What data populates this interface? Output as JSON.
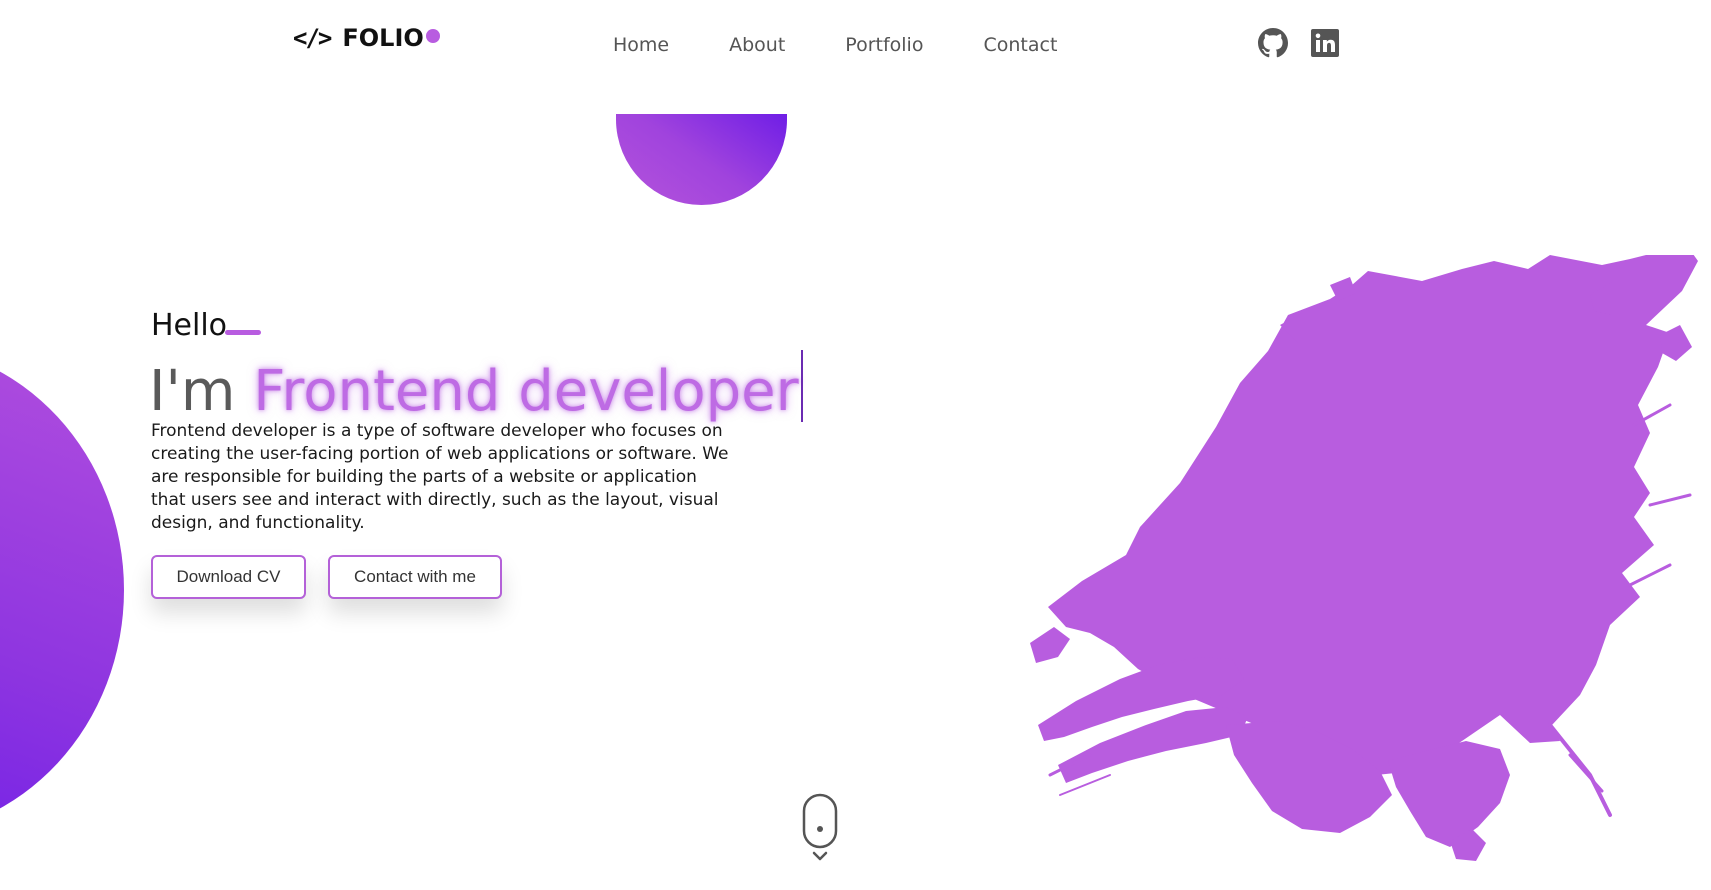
{
  "header": {
    "logo": {
      "code_symbol": "</>",
      "text": "FOLIO"
    },
    "nav": [
      {
        "label": "Home"
      },
      {
        "label": "About"
      },
      {
        "label": "Portfolio"
      },
      {
        "label": "Contact"
      }
    ],
    "social": [
      {
        "icon": "github-icon"
      },
      {
        "icon": "linkedin-icon"
      }
    ]
  },
  "hero": {
    "greeting": "Hello",
    "headline_prefix": "I'm ",
    "headline_role": "Frontend developer",
    "description": "Frontend developer is a type of software developer who focuses on creating the user-facing portion of web applications or software. We are responsible for building the parts of a website or application that users see and interact with directly, such as the layout, visual design, and functionality.",
    "buttons": {
      "download_cv": "Download CV",
      "contact": "Contact with me"
    }
  },
  "theme": {
    "accent": "#b85ce0",
    "gradient_start": "#b554dc",
    "gradient_end": "#6a1be8",
    "text_muted": "#555555",
    "text_dark": "#111111"
  },
  "decor": {
    "scroll_indicator_icon": "mouse-scroll-icon",
    "splash_icon": "paint-splash-icon"
  }
}
